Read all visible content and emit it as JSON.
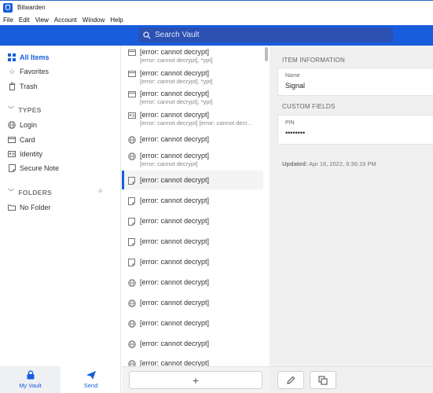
{
  "window": {
    "title": "Bitwarden"
  },
  "menu": [
    "File",
    "Edit",
    "View",
    "Account",
    "Window",
    "Help"
  ],
  "search": {
    "placeholder": "Search Vault"
  },
  "sidebar": {
    "all_items": "All Items",
    "favorites": "Favorites",
    "trash": "Trash",
    "types_header": "TYPES",
    "types": [
      "Login",
      "Card",
      "Identity",
      "Secure Note"
    ],
    "folders_header": "FOLDERS",
    "folders": [
      "No Folder"
    ]
  },
  "bottom_nav": {
    "my_vault": "My Vault",
    "send": "Send"
  },
  "list": {
    "items": [
      {
        "icon": "card-icon",
        "title": "[error: cannot decrypt]",
        "subtitle": "[error: cannot decrypt], *ypt]"
      },
      {
        "icon": "card-icon",
        "title": "[error: cannot decrypt]",
        "subtitle": "[error: cannot decrypt], *ypt]"
      },
      {
        "icon": "card-icon",
        "title": "[error: cannot decrypt]",
        "subtitle": "[error: cannot decrypt], *ypt]"
      },
      {
        "icon": "identity-icon",
        "title": "[error: cannot decrypt]",
        "subtitle": "[error: cannot decrypt] [error: cannot decr..."
      },
      {
        "icon": "globe-icon",
        "title": "[error: cannot decrypt]",
        "subtitle": ""
      },
      {
        "icon": "globe-icon",
        "title": "[error: cannot decrypt]",
        "subtitle": "[error: cannot decrypt]"
      },
      {
        "icon": "note-icon",
        "title": "[error: cannot decrypt]",
        "subtitle": ""
      },
      {
        "icon": "note-icon",
        "title": "[error: cannot decrypt]",
        "subtitle": ""
      },
      {
        "icon": "note-icon",
        "title": "[error: cannot decrypt]",
        "subtitle": ""
      },
      {
        "icon": "note-icon",
        "title": "[error: cannot decrypt]",
        "subtitle": ""
      },
      {
        "icon": "note-icon",
        "title": "[error: cannot decrypt]",
        "subtitle": ""
      },
      {
        "icon": "globe-icon",
        "title": "[error: cannot decrypt]",
        "subtitle": ""
      },
      {
        "icon": "globe-icon",
        "title": "[error: cannot decrypt]",
        "subtitle": ""
      },
      {
        "icon": "globe-icon",
        "title": "[error: cannot decrypt]",
        "subtitle": ""
      },
      {
        "icon": "globe-icon",
        "title": "[error: cannot decrypt]",
        "subtitle": ""
      },
      {
        "icon": "globe-icon",
        "title": "[error: cannot decrypt]",
        "subtitle": ""
      }
    ],
    "add_label": "+"
  },
  "detail": {
    "item_information_header": "ITEM INFORMATION",
    "name_label": "Name",
    "name_value": "Signal",
    "custom_fields_header": "CUSTOM FIELDS",
    "pin_label": "PIN",
    "pin_value": "••••••••",
    "updated_label": "Updated:",
    "updated_value": "Apr 16, 2022, 6:36:19 PM"
  },
  "colors": {
    "brand": "#175ddc",
    "search_bg": "#2b51b3"
  }
}
